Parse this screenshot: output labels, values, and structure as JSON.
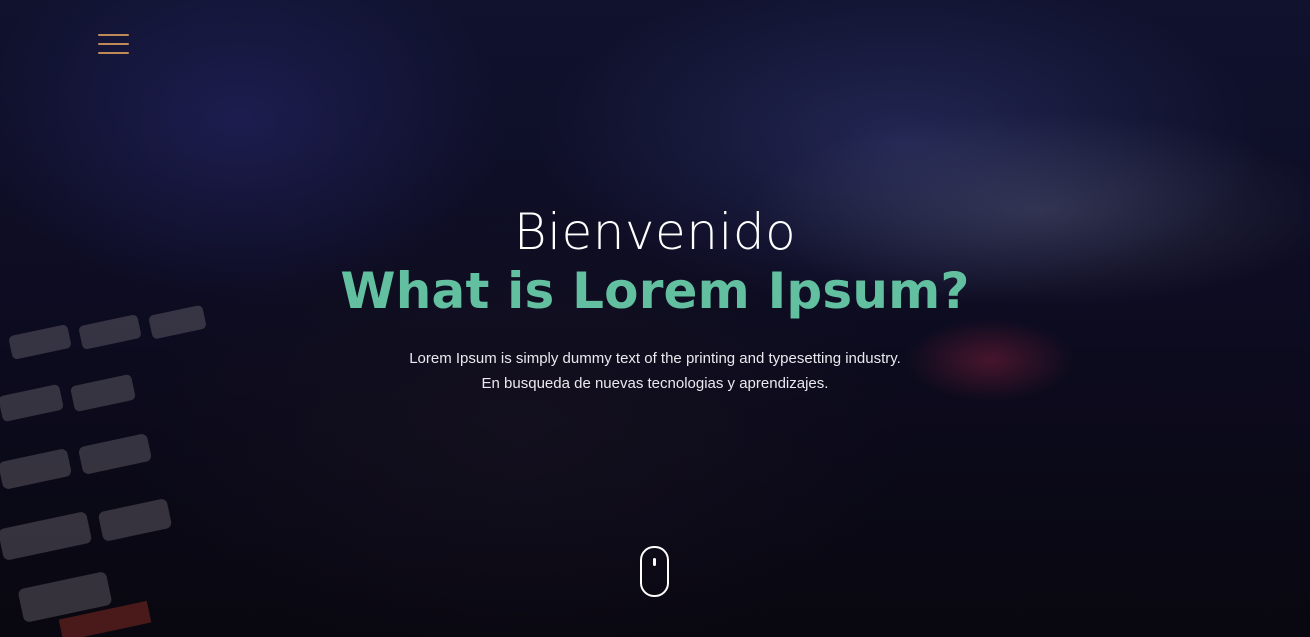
{
  "nav": {
    "menu_icon": "hamburger-menu-icon",
    "accent_color": "#c08a57"
  },
  "hero": {
    "welcome": "Bienvenido",
    "headline": "What is Lorem Ipsum?",
    "headline_color": "#62c0a0",
    "subtitle_line1": "Lorem Ipsum is simply dummy text of the printing and typesetting industry.",
    "subtitle_line2": "En busqueda de nuevas tecnologias y aprendizajes.",
    "scroll_icon": "mouse-scroll-icon"
  }
}
